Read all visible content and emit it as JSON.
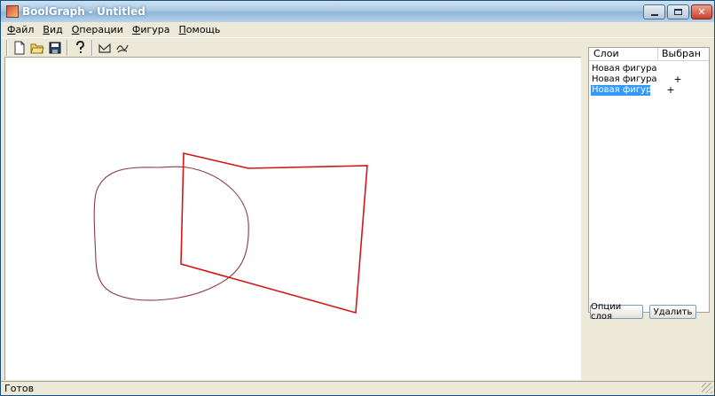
{
  "window": {
    "title": "BoolGraph - Untitled"
  },
  "menu": {
    "items": [
      {
        "label": "Файл",
        "accel": "Ф",
        "rest": "айл"
      },
      {
        "label": "Вид",
        "accel": "В",
        "rest": "ид"
      },
      {
        "label": "Операции",
        "accel": "О",
        "rest": "перации"
      },
      {
        "label": "Фигура",
        "accel": "Ф",
        "rest": "игура"
      },
      {
        "label": "Помощь",
        "accel": "П",
        "rest": "омощь"
      }
    ]
  },
  "toolbar": {
    "icons": [
      "new-file-icon",
      "open-folder-icon",
      "save-icon",
      "help-icon",
      "draw-polyline-icon",
      "draw-curve-icon"
    ]
  },
  "canvas": {
    "shape_colors": {
      "curve": "#8a3b43",
      "polygon": "#d01818"
    }
  },
  "layers": {
    "col_name": "Слои",
    "col_selected": "Выбран",
    "rows": [
      {
        "name": "Новая фигура",
        "selected": ""
      },
      {
        "name": "Новая фигура",
        "selected": "+"
      },
      {
        "name": "Новая фигура",
        "selected": "+"
      }
    ],
    "options_button": "Опции слоя",
    "delete_button": "Удалить"
  },
  "status": {
    "text": "Готов"
  }
}
